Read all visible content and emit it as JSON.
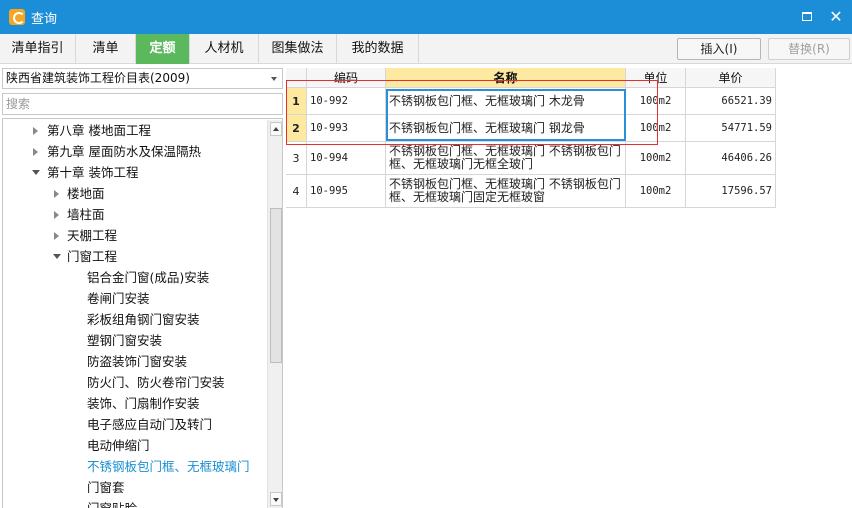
{
  "window": {
    "title": "查询",
    "maximize_label": "",
    "close_label": "✕"
  },
  "tabs": [
    {
      "label": "清单指引",
      "active": false
    },
    {
      "label": "清单",
      "active": false
    },
    {
      "label": "定额",
      "active": true
    },
    {
      "label": "人材机",
      "active": false
    },
    {
      "label": "图集做法",
      "active": false
    },
    {
      "label": "我的数据",
      "active": false
    }
  ],
  "toolbar": {
    "insert_label": "插入(I)",
    "replace_label": "替换(R)"
  },
  "left_panel": {
    "catalog_selected": "陕西省建筑装饰工程价目表(2009)",
    "search_placeholder": "搜索",
    "tree": [
      {
        "label": "第八章  楼地面工程",
        "level": 1,
        "state": "collapsed",
        "selected": false
      },
      {
        "label": "第九章  屋面防水及保温隔热",
        "level": 1,
        "state": "collapsed",
        "selected": false
      },
      {
        "label": "第十章  装饰工程",
        "level": 1,
        "state": "expanded",
        "selected": false
      },
      {
        "label": "楼地面",
        "level": 2,
        "state": "collapsed",
        "selected": false
      },
      {
        "label": "墙柱面",
        "level": 2,
        "state": "collapsed",
        "selected": false
      },
      {
        "label": "天棚工程",
        "level": 2,
        "state": "collapsed",
        "selected": false
      },
      {
        "label": "门窗工程",
        "level": 2,
        "state": "expanded",
        "selected": false
      },
      {
        "label": "铝合金门窗(成品)安装",
        "level": 3,
        "state": "leaf",
        "selected": false
      },
      {
        "label": "卷闸门安装",
        "level": 3,
        "state": "leaf",
        "selected": false
      },
      {
        "label": "彩板组角钢门窗安装",
        "level": 3,
        "state": "leaf",
        "selected": false
      },
      {
        "label": "塑钢门窗安装",
        "level": 3,
        "state": "leaf",
        "selected": false
      },
      {
        "label": "防盗装饰门窗安装",
        "level": 3,
        "state": "leaf",
        "selected": false
      },
      {
        "label": "防火门、防火卷帘门安装",
        "level": 3,
        "state": "leaf",
        "selected": false
      },
      {
        "label": "装饰、门扇制作安装",
        "level": 3,
        "state": "leaf",
        "selected": false
      },
      {
        "label": "电子感应自动门及转门",
        "level": 3,
        "state": "leaf",
        "selected": false
      },
      {
        "label": "电动伸缩门",
        "level": 3,
        "state": "leaf",
        "selected": false
      },
      {
        "label": "不锈钢板包门框、无框玻璃门",
        "level": 3,
        "state": "leaf",
        "selected": true
      },
      {
        "label": "门窗套",
        "level": 3,
        "state": "leaf",
        "selected": false
      },
      {
        "label": "门窗贴脸",
        "level": 3,
        "state": "leaf",
        "selected": false
      }
    ]
  },
  "table": {
    "columns": [
      "编码",
      "名称",
      "单位",
      "单价"
    ],
    "rows": [
      {
        "num": "1",
        "code": "10-992",
        "name": "不锈钢板包门框、无框玻璃门 木龙骨",
        "unit": "100m2",
        "price": "66521.39",
        "selected": true
      },
      {
        "num": "2",
        "code": "10-993",
        "name": "不锈钢板包门框、无框玻璃门 钢龙骨",
        "unit": "100m2",
        "price": "54771.59",
        "selected": true
      },
      {
        "num": "3",
        "code": "10-994",
        "name": "不锈钢板包门框、无框玻璃门 不锈钢板包门框、无框玻璃门无框全玻门",
        "unit": "100m2",
        "price": "46406.26",
        "selected": false
      },
      {
        "num": "4",
        "code": "10-995",
        "name": "不锈钢板包门框、无框玻璃门 不锈钢板包门框、无框玻璃门固定无框玻窗",
        "unit": "100m2",
        "price": "17596.57",
        "selected": false
      }
    ]
  },
  "colors": {
    "titlebar": "#1c8ed8",
    "active_tab": "#5cb85c",
    "selected_tree_item": "#1a8fd1",
    "header_highlight": "#fde9a0",
    "selection_red": "#e03030",
    "selection_blue": "#2a8fd8"
  },
  "icons": {
    "app": "app-logo-icon",
    "maximize": "maximize-icon",
    "close": "close-icon",
    "dropdown": "chevron-down-icon",
    "tree_collapsed": "triangle-right-icon",
    "tree_expanded": "triangle-down-icon"
  }
}
